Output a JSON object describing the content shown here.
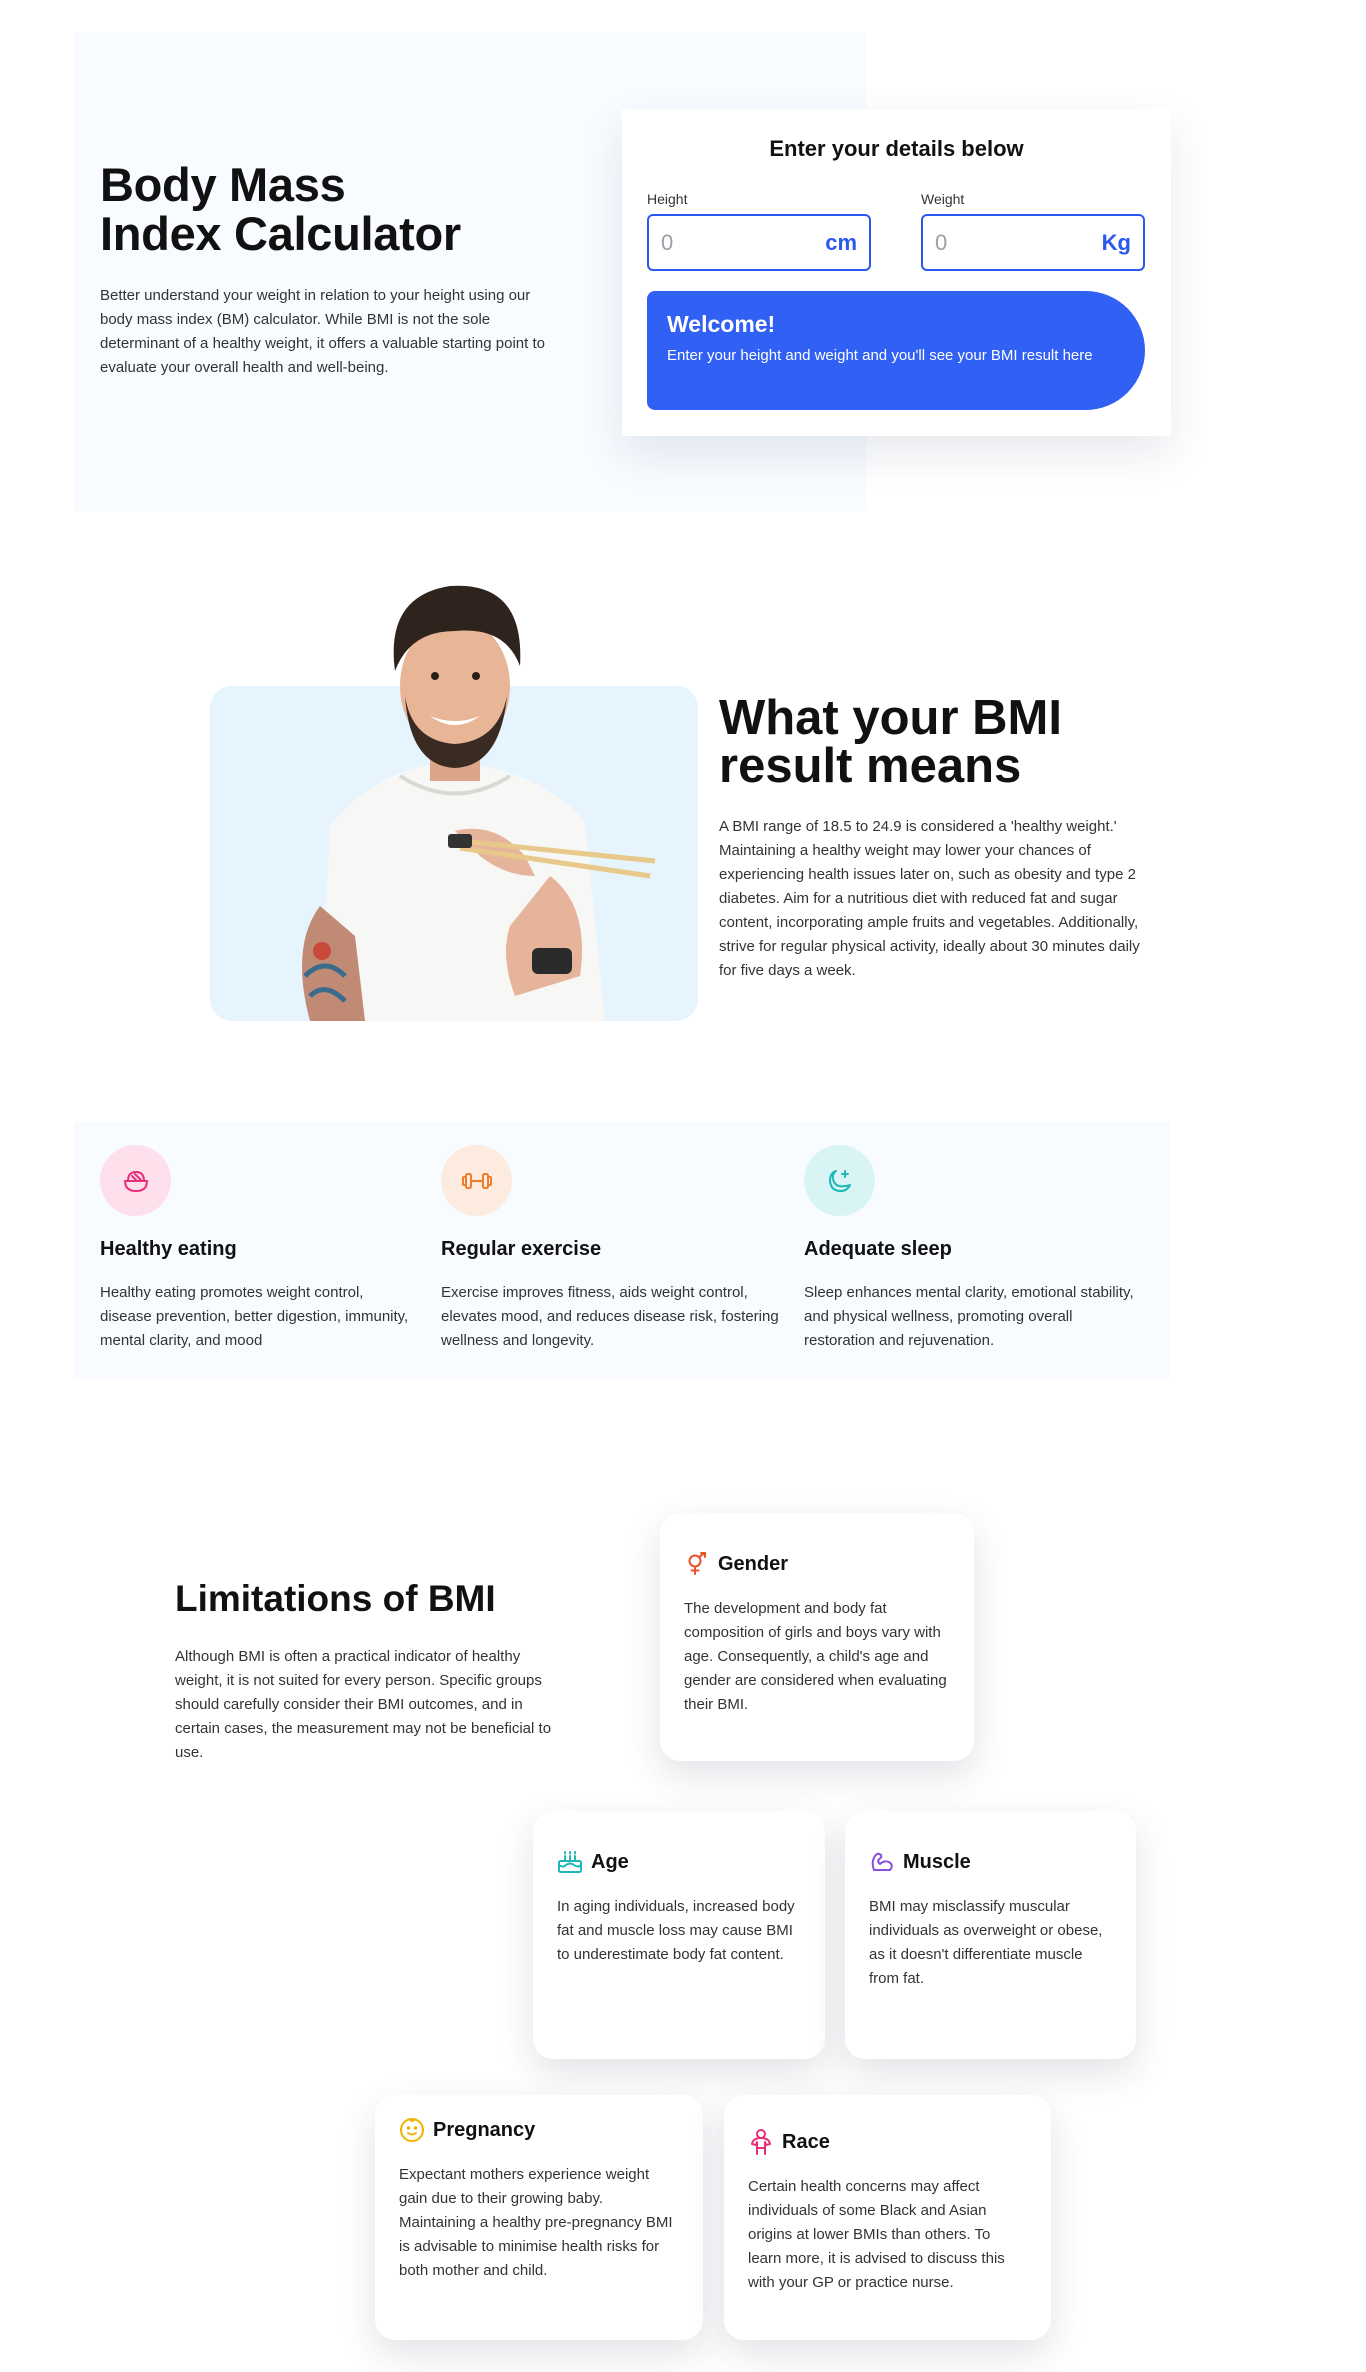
{
  "hero": {
    "title_line1": "Body Mass",
    "title_line2": "Index Calculator",
    "description": "Better understand your weight in relation to your height using our body mass index (BM) calculator. While BMI is not the sole determinant of a healthy weight, it offers a valuable starting point to evaluate your overall health and well-being."
  },
  "calculator": {
    "title": "Enter your details below",
    "height": {
      "label": "Height",
      "placeholder": "0",
      "value": "",
      "unit": "cm"
    },
    "weight": {
      "label": "Weight",
      "placeholder": "0",
      "value": "",
      "unit": "Kg"
    },
    "welcome": {
      "title": "Welcome!",
      "text": "Enter your height and weight and you'll see your BMI result here"
    }
  },
  "result": {
    "title_line1": "What your BMI",
    "title_line2": "result means",
    "text": "A BMI range of 18.5 to 24.9 is considered a 'healthy weight.' Maintaining a healthy weight may lower your chances of experiencing health issues later on, such as obesity and type 2 diabetes. Aim for a nutritious diet with reduced fat and sugar content, incorporating ample fruits and vegetables. Additionally, strive for regular physical activity, ideally about 30 minutes daily for five days a week."
  },
  "habits": [
    {
      "icon": "bowl-icon",
      "title": "Healthy eating",
      "text": "Healthy eating promotes weight control, disease prevention, better digestion, immunity, mental clarity, and mood",
      "icon_bg": "#fde0ec",
      "icon_color": "#e8307a"
    },
    {
      "icon": "dumbbell-icon",
      "title": "Regular exercise",
      "text": "Exercise improves fitness, aids weight control, elevates mood, and reduces disease risk, fostering wellness and longevity.",
      "icon_bg": "#fdebdf",
      "icon_color": "#ef7d2c"
    },
    {
      "icon": "moon-icon",
      "title": "Adequate sleep",
      "text": "Sleep enhances mental clarity, emotional stability, and physical wellness, promoting overall restoration and rejuvenation.",
      "icon_bg": "#d9f4f4",
      "icon_color": "#1fb8b8"
    }
  ],
  "limitations": {
    "title": "Limitations of BMI",
    "text": "Although BMI is often a practical indicator of healthy weight, it is not suited for every person. Specific groups should carefully consider their BMI outcomes, and in certain cases, the measurement may not be beneficial to use.",
    "cards": [
      {
        "icon": "gender-icon",
        "title": "Gender",
        "text": "The development and body fat composition of girls and boys vary with age. Consequently, a child's age and gender are considered when evaluating their BMI.",
        "icon_color": "#e8542a"
      },
      {
        "icon": "cake-icon",
        "title": "Age",
        "text": "In aging individuals, increased body fat and muscle loss may cause BMI to underestimate body fat content.",
        "icon_color": "#1fb8b8"
      },
      {
        "icon": "muscle-icon",
        "title": "Muscle",
        "text": "BMI may misclassify muscular individuals as overweight or obese, as it doesn't differentiate muscle from fat.",
        "icon_color": "#8a4fe0"
      },
      {
        "icon": "pregnancy-icon",
        "title": "Pregnancy",
        "text": "Expectant mothers experience weight gain due to their growing baby. Maintaining a healthy pre-pregnancy BMI is advisable to minimise health risks for both mother and child.",
        "icon_color": "#f0b400"
      },
      {
        "icon": "person-icon",
        "title": "Race",
        "text": "Certain health concerns may affect individuals of some Black and Asian origins at lower BMIs than others. To learn more, it is advised to discuss this with your GP or practice nurse.",
        "icon_color": "#e8307a"
      }
    ]
  }
}
